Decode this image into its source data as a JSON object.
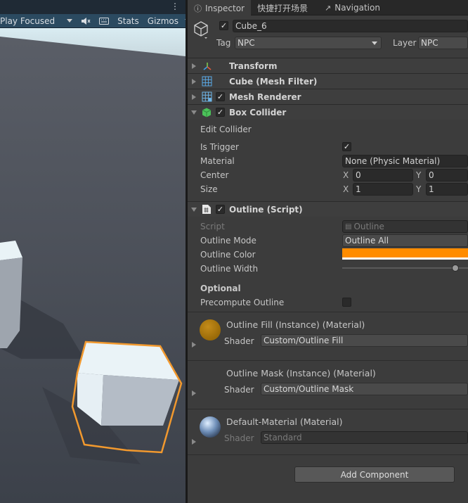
{
  "scene": {
    "toolbar": {
      "play_mode": "Play Focused",
      "stats": "Stats",
      "gizmos": "Gizmos"
    },
    "colors": {
      "sky": "#d6e8ee",
      "ground": "#414650",
      "selection": "#f2992e"
    }
  },
  "inspector": {
    "tabs": [
      {
        "label": "Inspector",
        "icon": "info-icon"
      },
      {
        "label": "快捷打开场景",
        "icon": ""
      },
      {
        "label": "Navigation",
        "icon": "navigation-icon"
      }
    ],
    "object": {
      "name": "Cube_6",
      "active": true,
      "tag_label": "Tag",
      "tag": "NPC",
      "layer_label": "Layer",
      "layer": "NPC"
    },
    "components": {
      "transform": {
        "title": "Transform"
      },
      "mesh_filter": {
        "title": "Cube (Mesh Filter)"
      },
      "mesh_renderer": {
        "title": "Mesh Renderer",
        "enabled": true
      },
      "box_collider": {
        "title": "Box Collider",
        "enabled": true,
        "edit_collider": "Edit Collider",
        "is_trigger_label": "Is Trigger",
        "is_trigger": true,
        "material_label": "Material",
        "material_value": "None (Physic Material)",
        "center_label": "Center",
        "center": {
          "x": "0",
          "y": "0"
        },
        "size_label": "Size",
        "size": {
          "x": "1",
          "y": "1"
        },
        "axis_x": "X",
        "axis_y": "Y"
      },
      "outline": {
        "title": "Outline (Script)",
        "enabled": true,
        "script_label": "Script",
        "script_value": "Outline",
        "mode_label": "Outline Mode",
        "mode_value": "Outline All",
        "color_label": "Outline Color",
        "color_value": "#ff8c00",
        "width_label": "Outline Width",
        "width_fraction": 0.9,
        "optional_label": "Optional",
        "precompute_label": "Precompute Outline",
        "precompute": false
      }
    },
    "materials": [
      {
        "name": "Outline Fill (Instance) (Material)",
        "shader_label": "Shader",
        "shader": "Custom/Outline Fill",
        "color": "#b07a10",
        "disabled": false
      },
      {
        "name": "Outline Mask (Instance) (Material)",
        "shader_label": "Shader",
        "shader": "Custom/Outline Mask",
        "color": "",
        "disabled": false
      },
      {
        "name": "Default-Material (Material)",
        "shader_label": "Shader",
        "shader": "Standard",
        "color": "#6f8fb8",
        "disabled": true
      }
    ],
    "add_component": "Add Component"
  }
}
